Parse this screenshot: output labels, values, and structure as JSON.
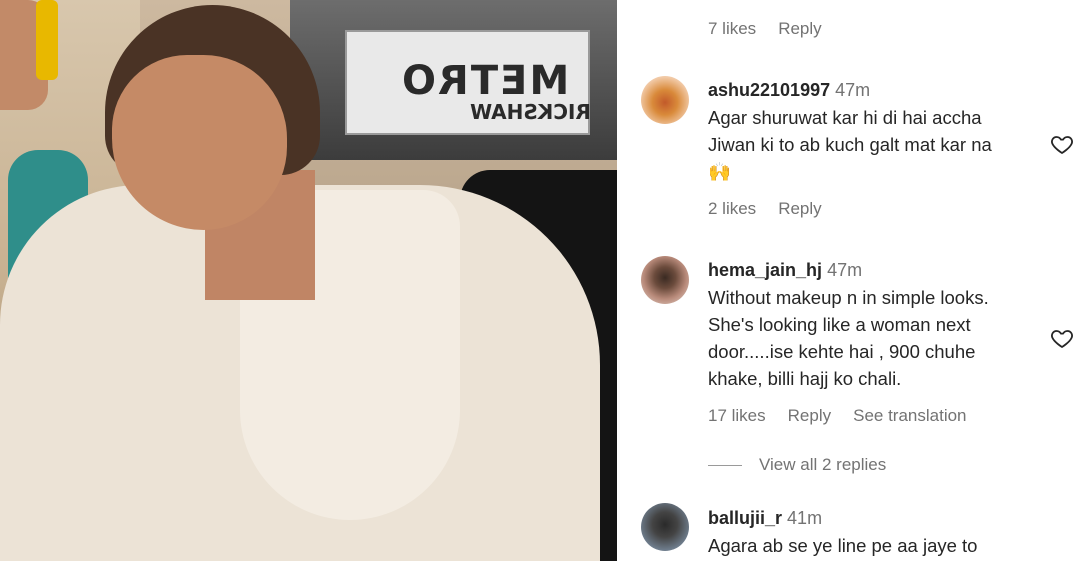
{
  "photo": {
    "sign_main": "METRO",
    "sign_sub": "RICKSHAW"
  },
  "comments": {
    "top_meta": {
      "likes": "7 likes",
      "reply": "Reply"
    },
    "items": [
      {
        "username": "ashu22101997",
        "time": "47m",
        "lines": [
          "Agar shuruwat kar hi di hai accha",
          "Jiwan ki to ab kuch galt mat kar na",
          "🙌"
        ],
        "likes": "2 likes",
        "reply": "Reply"
      },
      {
        "username": "hema_jain_hj",
        "time": "47m",
        "lines": [
          "Without makeup n in simple looks.",
          "She's looking like a woman next",
          "door.....ise kehte hai , 900 chuhe",
          "khake, billi hajj ko chali."
        ],
        "likes": "17 likes",
        "reply": "Reply",
        "translation": "See translation",
        "view_replies": "View all 2 replies"
      },
      {
        "username": "ballujii_r",
        "time": "41m",
        "lines": [
          "Agara ab se ye line pe aa jaye to"
        ]
      }
    ]
  },
  "colors": {
    "text": "#262626",
    "secondary": "#737373",
    "heart_outline": "#262626"
  },
  "icons": {
    "heart": "heart-outline-icon"
  }
}
